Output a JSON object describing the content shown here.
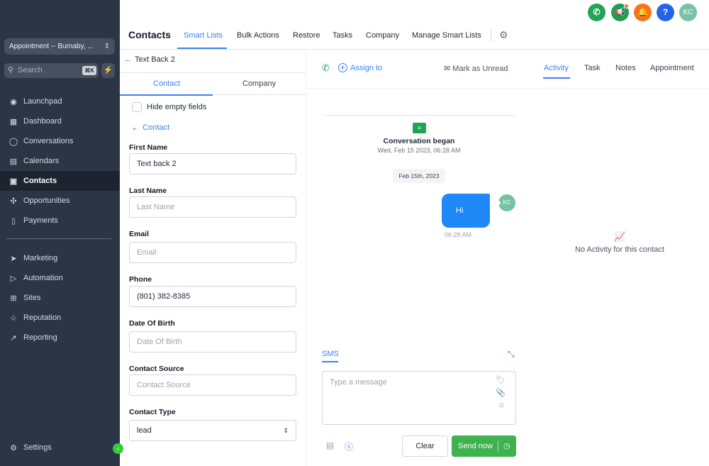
{
  "sidebar": {
    "location": "Appointment -- Burnaby, ...",
    "search_placeholder": "Search",
    "search_shortcut": "⌘K",
    "items": [
      {
        "label": "Launchpad",
        "icon": "rocket-icon"
      },
      {
        "label": "Dashboard",
        "icon": "grid-icon"
      },
      {
        "label": "Conversations",
        "icon": "chat-icon"
      },
      {
        "label": "Calendars",
        "icon": "calendar-icon"
      },
      {
        "label": "Contacts",
        "icon": "contacts-icon",
        "active": true
      },
      {
        "label": "Opportunities",
        "icon": "pipeline-icon"
      },
      {
        "label": "Payments",
        "icon": "receipt-icon"
      }
    ],
    "items2": [
      {
        "label": "Marketing",
        "icon": "send-icon"
      },
      {
        "label": "Automation",
        "icon": "automation-icon"
      },
      {
        "label": "Sites",
        "icon": "globe-icon"
      },
      {
        "label": "Reputation",
        "icon": "star-icon"
      },
      {
        "label": "Reporting",
        "icon": "trend-icon"
      }
    ],
    "settings": "Settings"
  },
  "topbar": {
    "avatar_initials": "KC",
    "buttons": [
      "phone-icon",
      "megaphone-icon",
      "bell-icon",
      "help-icon"
    ],
    "colors": {
      "phone": "#22a356",
      "megaphone": "#1f9d55",
      "bell": "#f97316",
      "help": "#2563eb",
      "avatar": "#78c2a4"
    }
  },
  "header": {
    "title": "Contacts",
    "tabs": [
      "Smart Lists",
      "Bulk Actions",
      "Restore",
      "Tasks",
      "Company",
      "Manage Smart Lists"
    ],
    "active_tab": "Smart Lists"
  },
  "contact_panel": {
    "back_label": "Text Back 2",
    "tabs": [
      "Contact",
      "Company"
    ],
    "hide_empty": "Hide empty fields",
    "section": "Contact",
    "fields": [
      {
        "label": "First Name",
        "value": "Text back 2",
        "placeholder": "First Name"
      },
      {
        "label": "Last Name",
        "value": "",
        "placeholder": "Last Name"
      },
      {
        "label": "Email",
        "value": "",
        "placeholder": "Email"
      },
      {
        "label": "Phone",
        "value": "(801) 382-8385",
        "placeholder": "Phone"
      },
      {
        "label": "Date Of Birth",
        "value": "",
        "placeholder": "Date Of Birth"
      },
      {
        "label": "Contact Source",
        "value": "",
        "placeholder": "Contact Source"
      },
      {
        "label": "Contact Type",
        "value": "lead",
        "placeholder": ""
      }
    ]
  },
  "conversation": {
    "assign": "Assign to",
    "mark_unread": "Mark as Unread",
    "began": "Conversation began",
    "began_time": "Wed, Feb 15 2023, 06:28 AM",
    "date_pill": "Feb 15th, 2023",
    "message": "Hi",
    "message_time": "06:28 AM",
    "sender_initials": "KC",
    "channel": "SMS",
    "input_placeholder": "Type a message",
    "clear": "Clear",
    "send": "Send now"
  },
  "activity": {
    "tabs": [
      "Activity",
      "Task",
      "Notes",
      "Appointment"
    ],
    "active_tab": "Activity",
    "empty": "No Activity for this contact"
  }
}
